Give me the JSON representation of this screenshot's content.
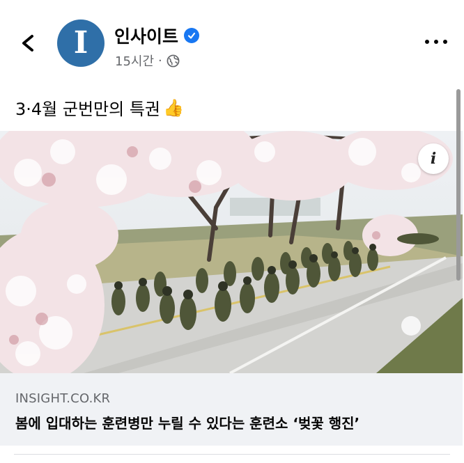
{
  "post": {
    "page_name": "인사이트",
    "avatar_letter": "I",
    "timestamp": "15시간",
    "separator": "·",
    "text": "3·4월 군번만의 특권",
    "emoji": "👍"
  },
  "link_preview": {
    "domain": "INSIGHT.CO.KR",
    "headline": "봄에 입대하는 훈련병만 누릴 수 있다는 훈련소 ‘벚꽃 행진’",
    "info_label": "i"
  },
  "colors": {
    "avatar": "#2f6fa8",
    "verified": "#1877f2",
    "link_box_bg": "#f0f2f5",
    "muted_text": "#65676b"
  }
}
